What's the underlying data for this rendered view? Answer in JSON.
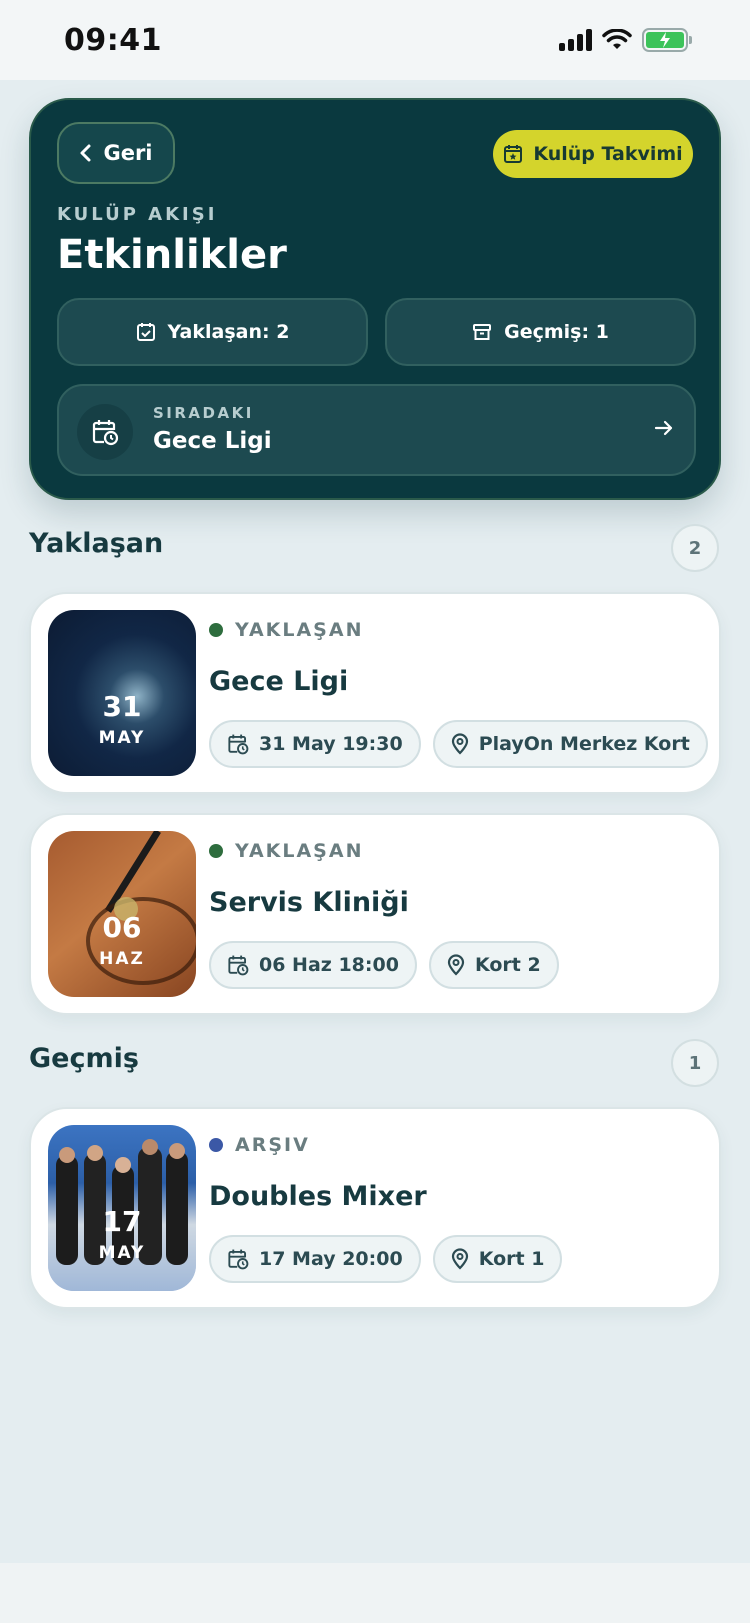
{
  "status_bar": {
    "time": "09:41"
  },
  "hero": {
    "back_label": "Geri",
    "calendar_label": "Kulüp Takvimi",
    "eyebrow": "KULÜP AKIŞI",
    "title": "Etkinlikler",
    "upcoming_stat": "Yaklaşan: 2",
    "past_stat": "Geçmiş: 1",
    "next_label": "SIRADAKI",
    "next_name": "Gece Ligi"
  },
  "sections": {
    "upcoming": {
      "title": "Yaklaşan",
      "count": "2"
    },
    "past": {
      "title": "Geçmiş",
      "count": "1"
    }
  },
  "events": [
    {
      "day": "31",
      "month": "MAY",
      "status": "YAKLAŞAN",
      "status_color": "#2e6d3e",
      "title": "Gece Ligi",
      "datetime": "31 May 19:30",
      "location": "PlayOn Merkez Kort"
    },
    {
      "day": "06",
      "month": "HAZ",
      "status": "YAKLAŞAN",
      "status_color": "#2e6d3e",
      "title": "Servis Kliniği",
      "datetime": "06 Haz 18:00",
      "location": "Kort 2"
    },
    {
      "day": "17",
      "month": "MAY",
      "status": "ARŞIV",
      "status_color": "#3b58a6",
      "title": "Doubles Mixer",
      "datetime": "17 May 20:00",
      "location": "Kort 1"
    }
  ],
  "colors": {
    "hero_bg": "#0a393f",
    "accent": "#d4d42c",
    "page_bg": "#e4edf0"
  }
}
